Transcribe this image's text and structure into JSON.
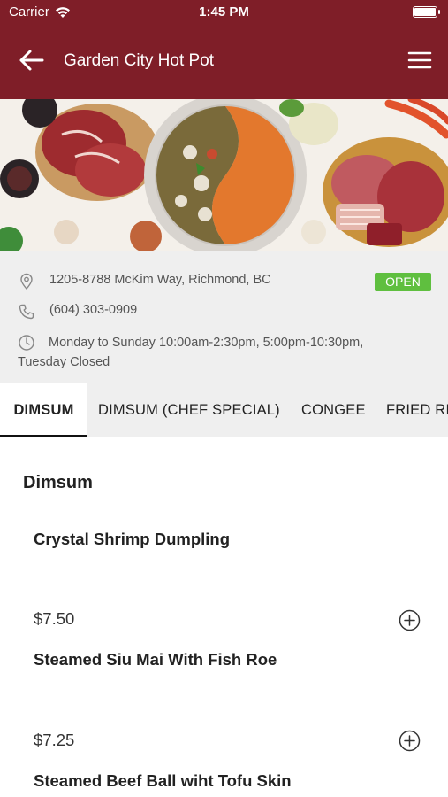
{
  "status_bar": {
    "carrier": "Carrier",
    "time": "1:45 PM"
  },
  "header": {
    "title": "Garden City Hot Pot",
    "back_icon": "arrow-left-icon",
    "menu_icon": "hamburger-menu-icon"
  },
  "colors": {
    "header_bg": "#7f1e28",
    "open_badge": "#5fbf3f",
    "info_bg": "#efefef"
  },
  "restaurant": {
    "address": "1205-8788 McKim Way, Richmond, BC",
    "phone": "(604) 303-0909",
    "hours_line1": "Monday to Sunday 10:00am-2:30pm, 5:00pm-10:30pm,",
    "hours_line2": "Tuesday Closed",
    "status": "OPEN"
  },
  "tabs": [
    {
      "label": "DIMSUM",
      "active": true
    },
    {
      "label": "DIMSUM (CHEF SPECIAL)",
      "active": false
    },
    {
      "label": "CONGEE",
      "active": false
    },
    {
      "label": "FRIED RICE",
      "active": false
    }
  ],
  "menu": {
    "section_title": "Dimsum",
    "items": [
      {
        "name": "Crystal Shrimp Dumpling",
        "price": "$7.50"
      },
      {
        "name": "Steamed Siu Mai With Fish Roe",
        "price": "$7.25"
      },
      {
        "name": "Steamed Beef Ball wiht Tofu Skin"
      }
    ]
  }
}
